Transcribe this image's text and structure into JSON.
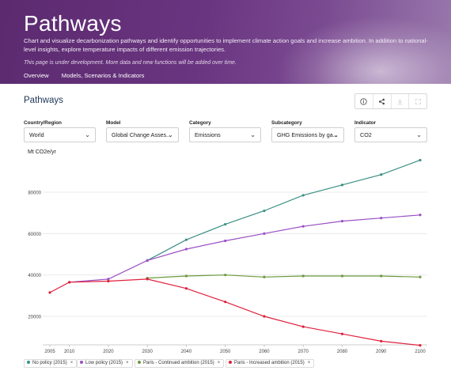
{
  "header": {
    "title": "Pathways",
    "description": "Chart and visualize decarbonization pathways and identify opportunities to implement climate action goals and increase ambition. In addition to national-level insights, explore temperature impacts of different emission trajectories.",
    "note": "This page is under development. More data and new functions will be added over time.",
    "nav": [
      "Overview",
      "Models, Scenarios & Indicators"
    ]
  },
  "section": {
    "title": "Pathways"
  },
  "toolbar": {
    "icons": [
      "info-icon",
      "share-icon",
      "download-icon",
      "expand-icon"
    ]
  },
  "filters": [
    {
      "label": "Country/Region",
      "value": "World"
    },
    {
      "label": "Model",
      "value": "Global Change Asses..."
    },
    {
      "label": "Category",
      "value": "Emissions"
    },
    {
      "label": "Subcategory",
      "value": "GHG Emissions by ga..."
    },
    {
      "label": "Indicator",
      "value": "CO2"
    }
  ],
  "chart_data": {
    "type": "line",
    "ylabel": "Mt CO2e/yr",
    "x": [
      2005,
      2010,
      2020,
      2030,
      2040,
      2050,
      2060,
      2070,
      2080,
      2090,
      2100
    ],
    "yticks": [
      20000,
      40000,
      60000,
      80000
    ],
    "ylim": [
      5000,
      95000
    ],
    "grid": true,
    "legend_position": "bottom",
    "series": [
      {
        "name": "No policy (2015)",
        "color": "#3a8f83",
        "x": [
          2030,
          2040,
          2050,
          2060,
          2070,
          2080,
          2090,
          2100
        ],
        "values": [
          47000,
          57000,
          64500,
          71000,
          78500,
          83500,
          88500,
          95500
        ]
      },
      {
        "name": "Low policy (2015)",
        "color": "#9b4fc4",
        "x": [
          2010,
          2020,
          2030,
          2040,
          2050,
          2060,
          2070,
          2080,
          2090,
          2100
        ],
        "values": [
          36500,
          38000,
          47000,
          52500,
          56500,
          60000,
          63500,
          66000,
          67500,
          69000
        ]
      },
      {
        "name": "Paris - Continued ambition (2015)",
        "color": "#6b9a3e",
        "x": [
          2030,
          2040,
          2050,
          2060,
          2070,
          2080,
          2090,
          2100
        ],
        "values": [
          38500,
          39500,
          40000,
          39000,
          39500,
          39500,
          39500,
          39000
        ]
      },
      {
        "name": "Paris - Increased ambition (2015)",
        "color": "#e0203c",
        "x": [
          2005,
          2010,
          2020,
          2030,
          2040,
          2050,
          2060,
          2070,
          2080,
          2090,
          2100
        ],
        "values": [
          31500,
          36500,
          37000,
          38000,
          33500,
          27000,
          20000,
          15000,
          11500,
          8000,
          6000
        ]
      }
    ]
  }
}
